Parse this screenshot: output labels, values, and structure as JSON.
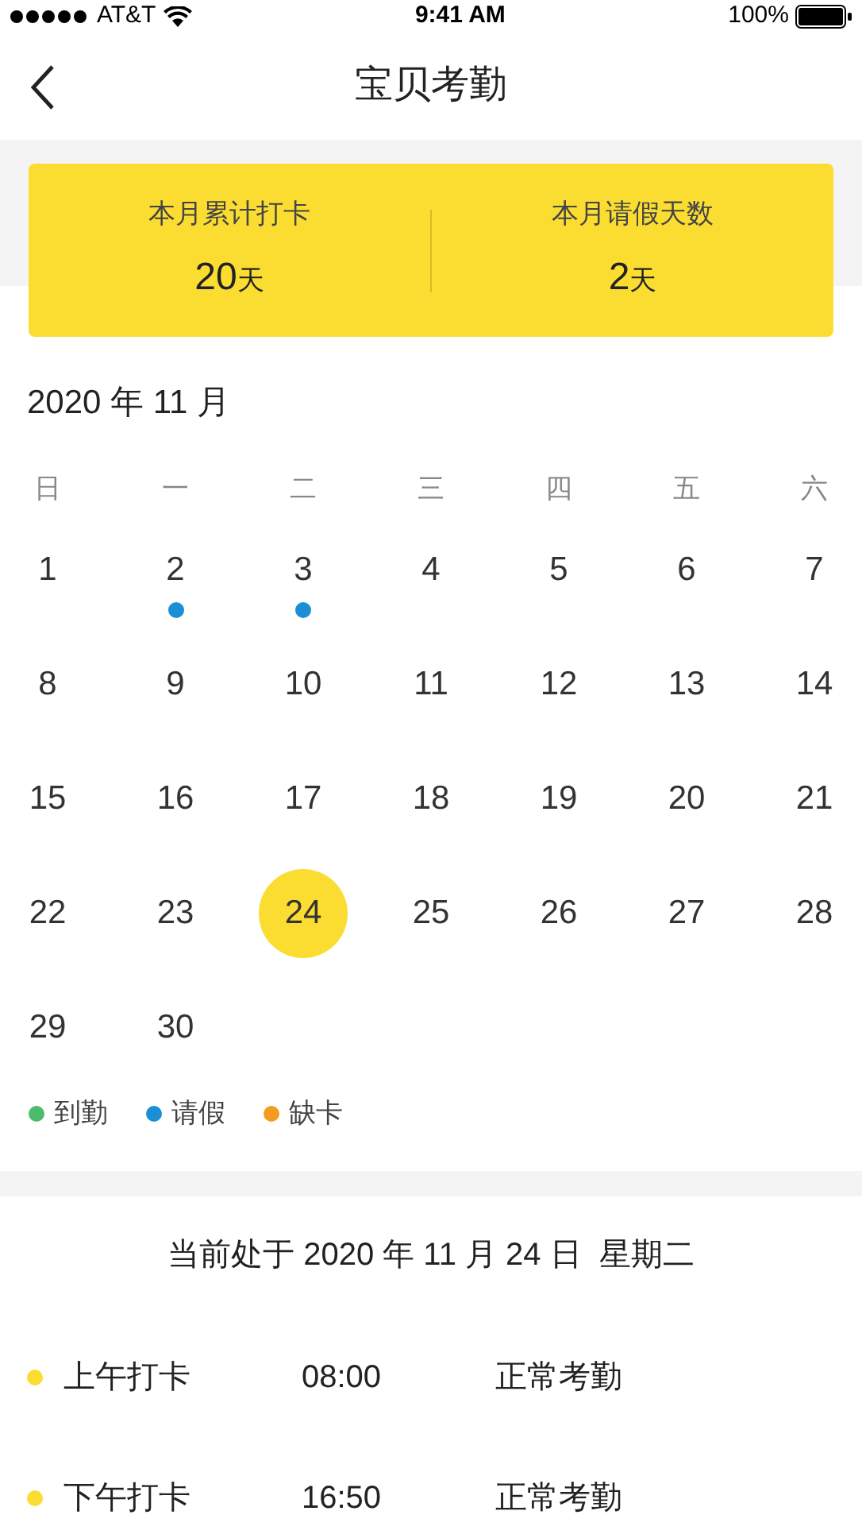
{
  "status_bar": {
    "carrier": "AT&T",
    "time": "9:41 AM",
    "battery": "100%"
  },
  "nav": {
    "title": "宝贝考勤"
  },
  "summary": [
    {
      "label": "本月累计打卡",
      "value": "20",
      "unit": "天"
    },
    {
      "label": "本月请假天数",
      "value": "2",
      "unit": "天"
    }
  ],
  "calendar": {
    "month_title": "2020 年 11 月",
    "weekdays": [
      "日",
      "一",
      "二",
      "三",
      "四",
      "五",
      "六"
    ],
    "days": [
      {
        "day": "1",
        "selected": false
      },
      {
        "day": "2",
        "selected": false,
        "color": "#1b8fd6"
      },
      {
        "day": "3",
        "selected": false,
        "color": "#1b8fd6"
      },
      {
        "day": "4",
        "selected": false
      },
      {
        "day": "5",
        "selected": false
      },
      {
        "day": "6",
        "selected": false
      },
      {
        "day": "7",
        "selected": false
      },
      {
        "day": "8",
        "selected": false
      },
      {
        "day": "9",
        "selected": false
      },
      {
        "day": "10",
        "selected": false
      },
      {
        "day": "11",
        "selected": false
      },
      {
        "day": "12",
        "selected": false
      },
      {
        "day": "13",
        "selected": false
      },
      {
        "day": "14",
        "selected": false
      },
      {
        "day": "15",
        "selected": false
      },
      {
        "day": "16",
        "selected": false
      },
      {
        "day": "17",
        "selected": false
      },
      {
        "day": "18",
        "selected": false
      },
      {
        "day": "19",
        "selected": false
      },
      {
        "day": "20",
        "selected": false
      },
      {
        "day": "21",
        "selected": false
      },
      {
        "day": "22",
        "selected": false
      },
      {
        "day": "23",
        "selected": false
      },
      {
        "day": "24",
        "selected": true
      },
      {
        "day": "25",
        "selected": false
      },
      {
        "day": "26",
        "selected": false
      },
      {
        "day": "27",
        "selected": false
      },
      {
        "day": "28",
        "selected": false
      },
      {
        "day": "29",
        "selected": false
      },
      {
        "day": "30",
        "selected": false
      }
    ]
  },
  "legend": [
    {
      "label": "到勤",
      "color": "#4cbb6c"
    },
    {
      "label": "请假",
      "color": "#1b8fd6"
    },
    {
      "label": "缺卡",
      "color": "#f39c1f"
    }
  ],
  "current_date": "当前处于 2020 年 11 月 24 日  星期二",
  "records": [
    {
      "label": "上午打卡",
      "time": "08:00",
      "status": "正常考勤"
    },
    {
      "label": "下午打卡",
      "time": "16:50",
      "status": "正常考勤"
    }
  ]
}
